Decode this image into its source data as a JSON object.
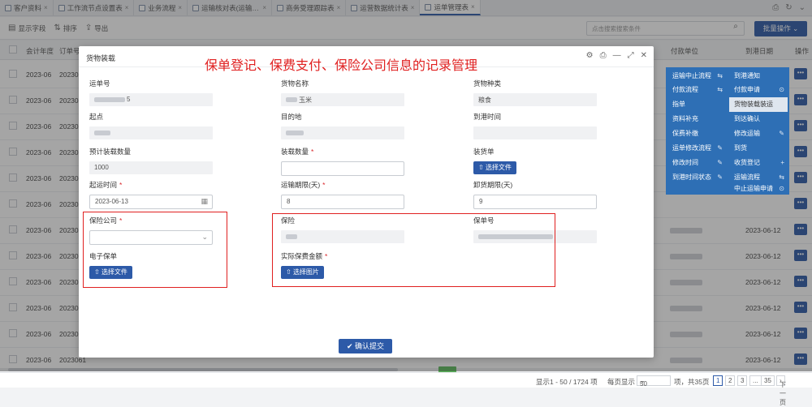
{
  "tabs": [
    {
      "label": "客户资料",
      "active": false
    },
    {
      "label": "工作流节点设置表",
      "active": false
    },
    {
      "label": "业务流程",
      "active": false
    },
    {
      "label": "运输核对表(运输单)",
      "active": false
    },
    {
      "label": "商务受理跟踪表",
      "active": false
    },
    {
      "label": "运营数据统计表",
      "active": false
    },
    {
      "label": "运单管理表",
      "active": true
    }
  ],
  "toolbar": {
    "show_fields": "显示字段",
    "sort": "排序",
    "export": "导出",
    "search_placeholder": "点击搜索搜索条件",
    "batch_label": "批量操作"
  },
  "grid": {
    "headers": [
      "会计年度",
      "订单号",
      "付款单位",
      "到港日期",
      "操作"
    ],
    "rows": [
      {
        "year": "2023-06",
        "order": "2023061",
        "date": ""
      },
      {
        "year": "2023-06",
        "order": "2023061",
        "date": ""
      },
      {
        "year": "2023-06",
        "order": "2023061",
        "date": ""
      },
      {
        "year": "2023-06",
        "order": "2023061",
        "date": ""
      },
      {
        "year": "2023-06",
        "order": "2023061",
        "date": ""
      },
      {
        "year": "2023-06",
        "order": "2023061",
        "date": ""
      },
      {
        "year": "2023-06",
        "order": "2023061",
        "date": "2023-06-12"
      },
      {
        "year": "2023-06",
        "order": "2023061",
        "date": "2023-06-12"
      },
      {
        "year": "2023-06",
        "order": "2023061",
        "date": "2023-06-12"
      },
      {
        "year": "2023-06",
        "order": "2023061",
        "date": "2023-06-12"
      },
      {
        "year": "2023-06",
        "order": "2023061",
        "date": "2023-06-12"
      },
      {
        "year": "2023-06",
        "order": "2023061",
        "date": "2023-06-12"
      }
    ],
    "op_label": "•••"
  },
  "pager": {
    "summary": "显示1 - 50 / 1724 项",
    "per_page_label": "每页显示",
    "per_page": "50",
    "total_pages_text": "项，共35页",
    "pages": [
      "1",
      "2",
      "3",
      "...",
      "35"
    ],
    "next": "下一页"
  },
  "ops_menu": [
    {
      "label": "运输中止流程",
      "icon": "⇆"
    },
    {
      "label": "到港通知",
      "icon": ""
    },
    {
      "label": "付款流程",
      "icon": "⇆"
    },
    {
      "label": "付款申请",
      "icon": "⊙"
    },
    {
      "label": "指单",
      "icon": ""
    },
    {
      "label": "货物装载装运",
      "icon": ""
    },
    {
      "label": "资料补充",
      "icon": ""
    },
    {
      "label": "到达确认",
      "icon": ""
    },
    {
      "label": "保费补缴",
      "icon": ""
    },
    {
      "label": "修改运输",
      "icon": "✎"
    },
    {
      "label": "运单修改流程",
      "icon": "✎"
    },
    {
      "label": "到货",
      "icon": ""
    },
    {
      "label": "修改时间",
      "icon": "✎"
    },
    {
      "label": "收货登记",
      "icon": "+"
    },
    {
      "label": "到港时间状态",
      "icon": "✎"
    },
    {
      "label": "运输流程",
      "icon": "⇆"
    },
    {
      "label": "",
      "icon": ""
    },
    {
      "label": "中止运输申请",
      "icon": "⊙"
    }
  ],
  "modal": {
    "title": "货物装载",
    "annotation": "保单登记、保费支付、保险公司信息的记录管理",
    "fields": {
      "waybill_no": {
        "label": "运单号",
        "value": "5"
      },
      "goods_name": {
        "label": "货物名称",
        "value": "玉米"
      },
      "goods_type": {
        "label": "货物种类",
        "value": "粮食"
      },
      "origin": {
        "label": "起点",
        "value": ""
      },
      "destination": {
        "label": "目的地",
        "value": ""
      },
      "arrival_time": {
        "label": "到港时间",
        "value": ""
      },
      "est_qty": {
        "label": "预计装载数量",
        "value": "1000"
      },
      "load_qty": {
        "label": "装载数量",
        "value": ""
      },
      "load_doc": {
        "label": "装货单",
        "button": "选择文件"
      },
      "ship_time": {
        "label": "起运时间",
        "value": "2023-06-13"
      },
      "transit_days": {
        "label": "运输期限(天)",
        "value": "8"
      },
      "unload_days": {
        "label": "卸货期限(天)",
        "value": "9"
      },
      "insurer": {
        "label": "保险公司",
        "value": ""
      },
      "insurance": {
        "label": "保险",
        "value": ""
      },
      "policy_no": {
        "label": "保单号",
        "value": ""
      },
      "e_policy": {
        "label": "电子保单",
        "button": "选择文件"
      },
      "premium_paid": {
        "label": "实际保费金额",
        "button": "选择图片"
      }
    },
    "submit": "确认提交"
  },
  "colors": {
    "primary": "#2d5aa8",
    "menu": "#2e6fb5",
    "annotation": "#e02020"
  }
}
